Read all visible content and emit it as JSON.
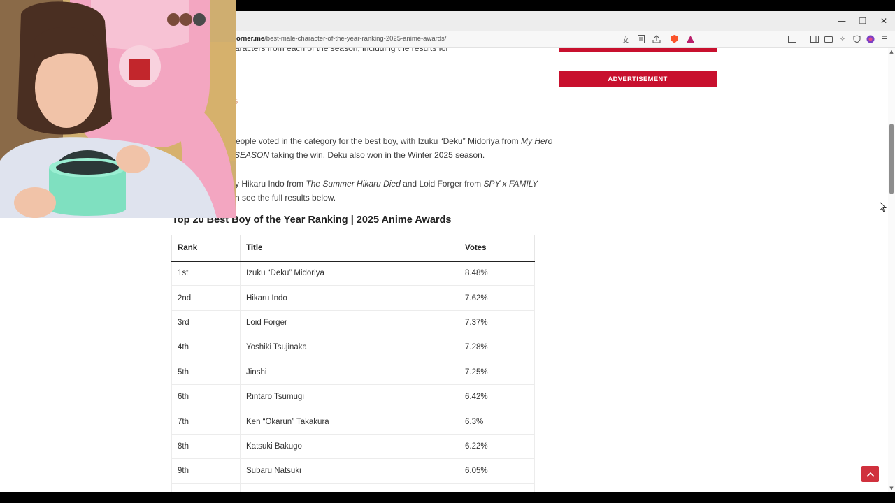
{
  "browser": {
    "url_domain": "orner.me",
    "url_path": "/best-male-character-of-the-year-ranking-2025-anime-awards/",
    "window_controls": {
      "minimize": "—",
      "restore": "❐",
      "close": "✕"
    }
  },
  "article": {
    "intro_fragment": "aracters from each of the season, including the results for",
    "link_fragment": "5",
    "para2_line1_pre": "eople voted in the category for the best boy, with Izuku “Deku” Midoriya from ",
    "para2_line1_italic": "My Hero",
    "para2_line2_italic": "SEASON",
    "para2_line2_post": " taking the win. Deku also won in the Winter 2025 season.",
    "para3_line1_pre": "y Hikaru Indo from ",
    "para3_line1_italic1": "The Summer Hikaru Died",
    "para3_line1_mid": " and Loid Forger from ",
    "para3_line1_italic2": "SPY x FAMILY",
    "para3_line2": "n see the full results below.",
    "heading": "Top 20 Best Boy of the Year Ranking | 2025 Anime Awards"
  },
  "table": {
    "headers": [
      "Rank",
      "Title",
      "Votes"
    ],
    "rows": [
      [
        "1st",
        "Izuku “Deku” Midoriya",
        "8.48%"
      ],
      [
        "2nd",
        "Hikaru Indo",
        "7.62%"
      ],
      [
        "3rd",
        "Loid Forger",
        "7.37%"
      ],
      [
        "4th",
        "Yoshiki Tsujinaka",
        "7.28%"
      ],
      [
        "5th",
        "Jinshi",
        "7.25%"
      ],
      [
        "6th",
        "Rintaro Tsumugi",
        "6.42%"
      ],
      [
        "7th",
        "Ken “Okarun” Takakura",
        "6.3%"
      ],
      [
        "8th",
        "Katsuki Bakugo",
        "6.22%"
      ],
      [
        "9th",
        "Subaru Natsuki",
        "6.05%"
      ]
    ]
  },
  "sidebar": {
    "advertisement": "ADVERTISEMENT"
  },
  "colors": {
    "accent_red": "#c8102e",
    "to_top_red": "#d0313d"
  }
}
